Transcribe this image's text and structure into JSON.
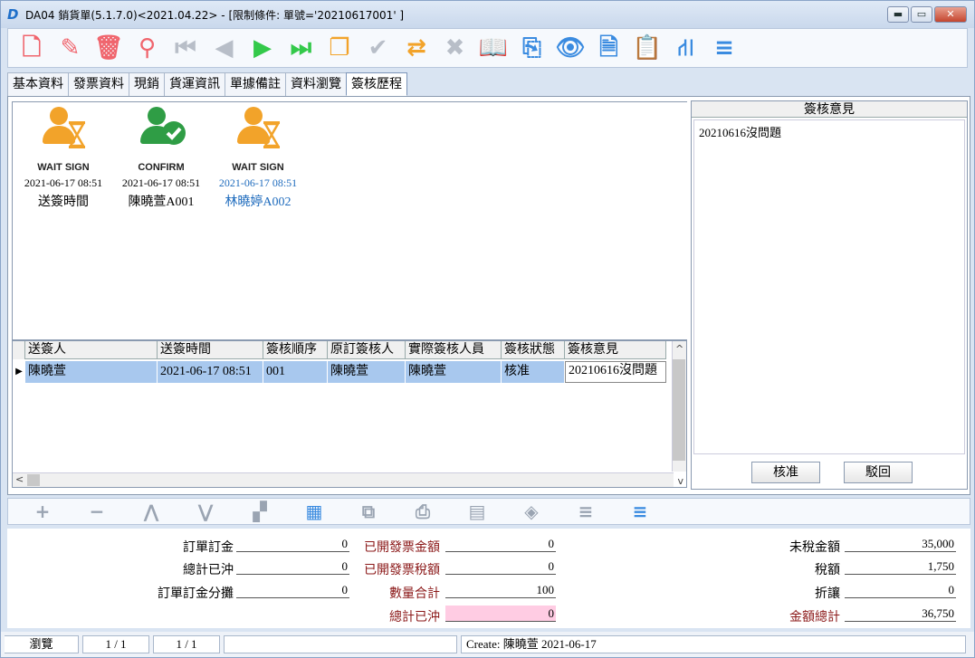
{
  "window": {
    "title": "DA04 銷貨單(5.1.7.0)<2021.04.22> - [限制條件: 單號='20210617001' ]",
    "app_icon": "D",
    "minimize": "▬",
    "maximize": "▭",
    "close": "✕"
  },
  "toolbar": [
    {
      "name": "new-doc-icon",
      "glyph": "🗋",
      "color": "#f0656d"
    },
    {
      "name": "edit-pencil-icon",
      "glyph": "✎",
      "color": "#f0656d"
    },
    {
      "name": "delete-trash-icon",
      "glyph": "🗑",
      "color": "#f0656d"
    },
    {
      "name": "search-icon",
      "glyph": "⚲",
      "color": "#f0656d"
    },
    {
      "name": "first-record-icon",
      "glyph": "⏮",
      "color": "#b8bec8"
    },
    {
      "name": "prev-record-icon",
      "glyph": "◀",
      "color": "#b8bec8"
    },
    {
      "name": "next-record-icon",
      "glyph": "▶",
      "color": "#33c94a"
    },
    {
      "name": "last-record-icon",
      "glyph": "⏭",
      "color": "#33c94a"
    },
    {
      "name": "copy-doc-icon",
      "glyph": "❐",
      "color": "#f2a32a"
    },
    {
      "name": "confirm-check-icon",
      "glyph": "✔",
      "color": "#b8bec8"
    },
    {
      "name": "transfer-icon",
      "glyph": "⇄",
      "color": "#f2a32a"
    },
    {
      "name": "cancel-x-icon",
      "glyph": "✖",
      "color": "#b8bec8"
    },
    {
      "name": "open-book-icon",
      "glyph": "📖",
      "color": "#3a8be0"
    },
    {
      "name": "attachment-clip-icon",
      "glyph": "⎘",
      "color": "#3a8be0"
    },
    {
      "name": "view-eye-icon",
      "glyph": "👁",
      "color": "#3a8be0"
    },
    {
      "name": "export-xls-icon",
      "glyph": "🗎",
      "color": "#3a8be0"
    },
    {
      "name": "clipboard-edit-icon",
      "glyph": "📋",
      "color": "#3a8be0"
    },
    {
      "name": "flow-tree-icon",
      "glyph": "⛙",
      "color": "#3a8be0"
    },
    {
      "name": "menu-lines-icon",
      "glyph": "≡",
      "color": "#3a8be0"
    }
  ],
  "tabs": [
    "基本資料",
    "發票資料",
    "現銷",
    "貨運資訊",
    "單據備註",
    "資料瀏覽",
    "簽核歷程"
  ],
  "active_tab": 6,
  "timeline": [
    {
      "label": "WAIT SIGN",
      "status": "wait",
      "datetime": "2021-06-17 08:51",
      "name": "送簽時間",
      "highlight": false
    },
    {
      "label": "CONFIRM",
      "status": "confirm",
      "datetime": "2021-06-17 08:51",
      "name": "陳曉萱A001",
      "highlight": false
    },
    {
      "label": "WAIT SIGN",
      "status": "wait",
      "datetime": "2021-06-17 08:51",
      "name": "林曉婷A002",
      "highlight": true
    }
  ],
  "grid": {
    "columns": [
      "送簽人",
      "送簽時間",
      "簽核順序",
      "原訂簽核人",
      "實際簽核人員",
      "簽核狀態",
      "簽核意見"
    ],
    "rows": [
      [
        "陳曉萱",
        "2021-06-17 08:51",
        "001",
        "陳曉萱",
        "陳曉萱",
        "核准",
        "20210616沒問題"
      ]
    ],
    "row_marker": "▶",
    "scroll_up": "^",
    "scroll_down": "v",
    "scroll_left": "<",
    "scroll_right": ">"
  },
  "opinion": {
    "header": "簽核意見",
    "text": "20210616沒問題",
    "approve": "核准",
    "reject": "駁回"
  },
  "nav_buttons": [
    {
      "name": "add-row-icon",
      "glyph": "+"
    },
    {
      "name": "remove-row-icon",
      "glyph": "−"
    },
    {
      "name": "move-up-icon",
      "glyph": "⋀"
    },
    {
      "name": "move-down-icon",
      "glyph": "⋁"
    },
    {
      "name": "group-icon",
      "glyph": "▞"
    },
    {
      "name": "calendar-icon",
      "glyph": "▦"
    },
    {
      "name": "copy-rows-icon",
      "glyph": "⧉"
    },
    {
      "name": "print-icon",
      "glyph": "⎙"
    },
    {
      "name": "document-icon",
      "glyph": "▤"
    },
    {
      "name": "tag-icon",
      "glyph": "◈"
    },
    {
      "name": "list-icon",
      "glyph": "≡"
    },
    {
      "name": "list-blue-icon",
      "glyph": "≡"
    }
  ],
  "summary": {
    "order_deposit_label": "訂單訂金",
    "order_deposit": "0",
    "total_offset_label": "總計已沖",
    "total_offset": "0",
    "deposit_alloc_label": "訂單訂金分攤",
    "deposit_alloc": "0",
    "invoiced_amount_label": "已開發票金額",
    "invoiced_amount": "0",
    "invoiced_tax_label": "已開發票稅額",
    "invoiced_tax": "0",
    "qty_total_label": "數量合計",
    "qty_total": "100",
    "total_offset2_label": "總計已沖",
    "total_offset2": "0",
    "pretax_label": "未稅金額",
    "pretax": "35,000",
    "tax_label": "稅額",
    "tax": "1,750",
    "discount_label": "折讓",
    "discount": "0",
    "grand_total_label": "金額總計",
    "grand_total": "36,750"
  },
  "statusbar": {
    "mode": "瀏覽",
    "page1": "1 / 1",
    "page2": "1 / 1",
    "create": "Create: 陳曉萱  2021-06-17"
  },
  "colors": {
    "accent_red": "#f0656d",
    "accent_green": "#33c94a",
    "accent_orange": "#f2a32a",
    "accent_blue": "#3a8be0",
    "selection": "#a8c8ee",
    "highlight_field": "#ffcce3"
  }
}
